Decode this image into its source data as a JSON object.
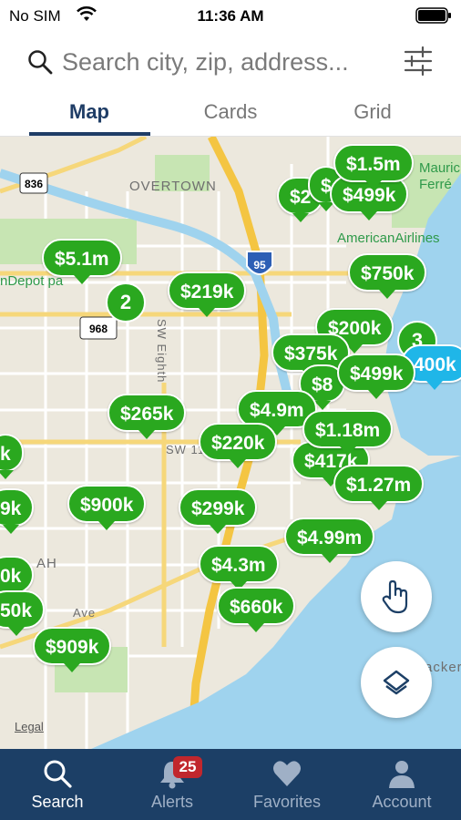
{
  "status_bar": {
    "carrier": "No SIM",
    "time": "11:36 AM"
  },
  "search": {
    "placeholder": "Search city, zip, address..."
  },
  "tabs": [
    {
      "label": "Map",
      "active": true
    },
    {
      "label": "Cards",
      "active": false
    },
    {
      "label": "Grid",
      "active": false
    }
  ],
  "map": {
    "labels": {
      "overtown": "OVERTOWN",
      "american_airlines": "AmericanAirlines",
      "maurice_1": "Mauric",
      "maurice_2": "Ferré",
      "depot": "nDepot pa",
      "sw_eighth": "SW Eighth",
      "sw_11": "SW 11",
      "ah": "AH",
      "ave": "Ave",
      "ackers": "ackers",
      "shield_836": "836",
      "shield_95": "95",
      "shield_968": "968"
    },
    "pins": [
      {
        "label": "$1.5m"
      },
      {
        "label": "$2"
      },
      {
        "label": "$"
      },
      {
        "label": "$499k"
      },
      {
        "label": "$5.1m"
      },
      {
        "label": "$219k"
      },
      {
        "label": "$750k"
      },
      {
        "label": "$200k"
      },
      {
        "label": "$375k"
      },
      {
        "label": "$8"
      },
      {
        "label": "$499k"
      },
      {
        "label": "400k"
      },
      {
        "label": "$265k"
      },
      {
        "label": "$4.9m"
      },
      {
        "label": "$1.18m"
      },
      {
        "label": "$220k"
      },
      {
        "label": "$417k"
      },
      {
        "label": "$1.27m"
      },
      {
        "label": "k"
      },
      {
        "label": "$900k"
      },
      {
        "label": "9k"
      },
      {
        "label": "$299k"
      },
      {
        "label": "$4.99m"
      },
      {
        "label": "0k"
      },
      {
        "label": "$4.3m"
      },
      {
        "label": "50k"
      },
      {
        "label": "$660k"
      },
      {
        "label": "$909k"
      }
    ],
    "clusters": [
      {
        "label": "2"
      },
      {
        "label": "3"
      }
    ],
    "legal": "Legal"
  },
  "fabs": {
    "draw": "hand-pointer-icon",
    "layers": "layers-icon"
  },
  "bottom_nav": [
    {
      "label": "Search",
      "icon": "search-icon",
      "active": true
    },
    {
      "label": "Alerts",
      "icon": "bell-icon",
      "active": false,
      "badge": "25"
    },
    {
      "label": "Favorites",
      "icon": "heart-icon",
      "active": false
    },
    {
      "label": "Account",
      "icon": "person-icon",
      "active": false
    }
  ],
  "colors": {
    "pin_green": "#2aa81f",
    "pin_blue": "#1fb6e8",
    "nav_bg": "#1c3f66",
    "tab_active": "#1f3d66",
    "water": "#9fd3ee"
  }
}
